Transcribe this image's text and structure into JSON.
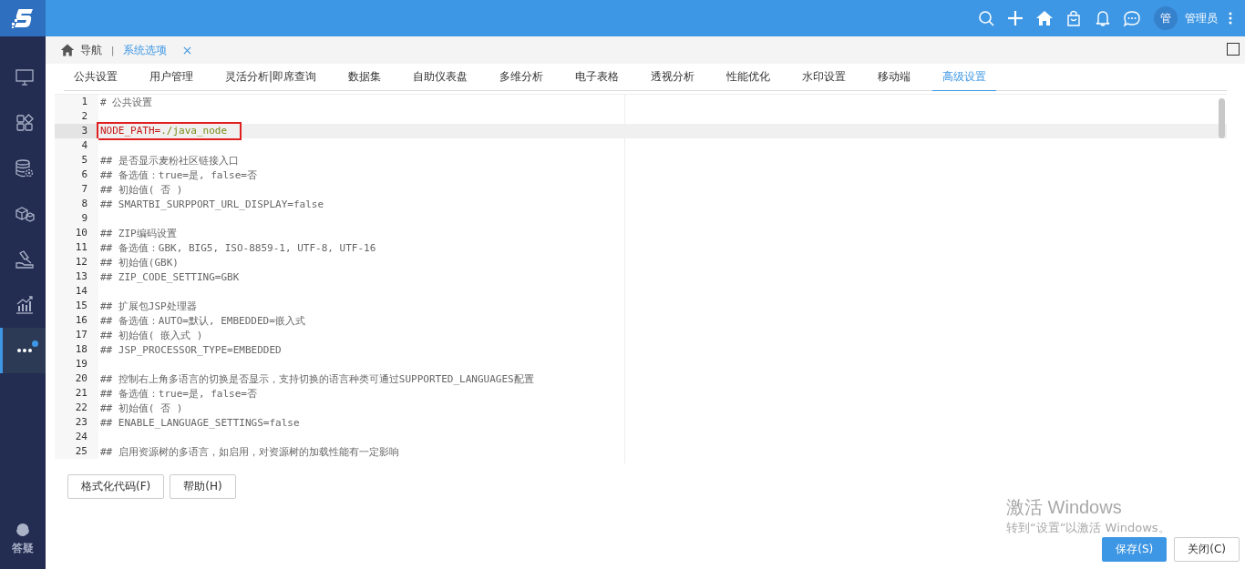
{
  "header": {
    "actions": [
      {
        "kind": "search"
      },
      {
        "kind": "plus"
      },
      {
        "kind": "home"
      },
      {
        "kind": "bag"
      },
      {
        "kind": "bell"
      },
      {
        "kind": "chat"
      }
    ],
    "avatar": "管",
    "user": "管理员"
  },
  "sidebar": {
    "items": [
      {
        "kind": "monitor",
        "selected": false,
        "badge": false
      },
      {
        "kind": "widgets",
        "selected": false,
        "badge": false
      },
      {
        "kind": "database",
        "selected": false,
        "badge": false
      },
      {
        "kind": "cubes",
        "selected": false,
        "badge": false
      },
      {
        "kind": "hammer",
        "selected": false,
        "badge": false
      },
      {
        "kind": "chart",
        "selected": false,
        "badge": false
      },
      {
        "kind": "more",
        "selected": true,
        "badge": true
      }
    ],
    "help": "答疑"
  },
  "breadcrumb": {
    "home": "导航",
    "separator": "|",
    "page": "系统选项"
  },
  "tabs": [
    {
      "label": "公共设置",
      "selected": false
    },
    {
      "label": "用户管理",
      "selected": false
    },
    {
      "label": "灵活分析|即席查询",
      "selected": false
    },
    {
      "label": "数据集",
      "selected": false
    },
    {
      "label": "自助仪表盘",
      "selected": false
    },
    {
      "label": "多维分析",
      "selected": false
    },
    {
      "label": "电子表格",
      "selected": false
    },
    {
      "label": "透视分析",
      "selected": false
    },
    {
      "label": "性能优化",
      "selected": false
    },
    {
      "label": "水印设置",
      "selected": false
    },
    {
      "label": "移动端",
      "selected": false
    },
    {
      "label": "高级设置",
      "selected": true
    }
  ],
  "editor": {
    "lines": [
      {
        "number": "1",
        "kind": "comment",
        "text": "# 公共设置",
        "current": false,
        "boxed": false
      },
      {
        "number": "2",
        "kind": "blank",
        "current": false,
        "boxed": false
      },
      {
        "number": "3",
        "kind": "setting",
        "key": "NODE_PATH",
        "separator": "=",
        "value": "./java_node",
        "current": true,
        "boxed": true
      },
      {
        "number": "4",
        "kind": "blank",
        "current": false,
        "boxed": false
      },
      {
        "number": "5",
        "kind": "comment",
        "text": "## 是否显示麦粉社区链接入口",
        "current": false,
        "boxed": false
      },
      {
        "number": "6",
        "kind": "comment",
        "text": "## 备选值：true=是, false=否",
        "current": false,
        "boxed": false
      },
      {
        "number": "7",
        "kind": "comment",
        "text": "## 初始值( 否 )",
        "current": false,
        "boxed": false
      },
      {
        "number": "8",
        "kind": "comment",
        "text": "## SMARTBI_SURPPORT_URL_DISPLAY=false",
        "current": false,
        "boxed": false
      },
      {
        "number": "9",
        "kind": "blank",
        "current": false,
        "boxed": false
      },
      {
        "number": "10",
        "kind": "comment",
        "text": "## ZIP编码设置",
        "current": false,
        "boxed": false
      },
      {
        "number": "11",
        "kind": "comment",
        "text": "## 备选值：GBK, BIG5, ISO-8859-1, UTF-8, UTF-16",
        "current": false,
        "boxed": false
      },
      {
        "number": "12",
        "kind": "comment",
        "text": "## 初始值(GBK)",
        "current": false,
        "boxed": false
      },
      {
        "number": "13",
        "kind": "comment",
        "text": "## ZIP_CODE_SETTING=GBK",
        "current": false,
        "boxed": false
      },
      {
        "number": "14",
        "kind": "blank",
        "current": false,
        "boxed": false
      },
      {
        "number": "15",
        "kind": "comment",
        "text": "## 扩展包JSP处理器",
        "current": false,
        "boxed": false
      },
      {
        "number": "16",
        "kind": "comment",
        "text": "## 备选值：AUTO=默认, EMBEDDED=嵌入式",
        "current": false,
        "boxed": false
      },
      {
        "number": "17",
        "kind": "comment",
        "text": "## 初始值( 嵌入式 )",
        "current": false,
        "boxed": false
      },
      {
        "number": "18",
        "kind": "comment",
        "text": "## JSP_PROCESSOR_TYPE=EMBEDDED",
        "current": false,
        "boxed": false
      },
      {
        "number": "19",
        "kind": "blank",
        "current": false,
        "boxed": false
      },
      {
        "number": "20",
        "kind": "comment",
        "text": "## 控制右上角多语言的切换是否显示，支持切换的语言种类可通过SUPPORTED_LANGUAGES配置",
        "current": false,
        "boxed": false
      },
      {
        "number": "21",
        "kind": "comment",
        "text": "## 备选值：true=是, false=否",
        "current": false,
        "boxed": false
      },
      {
        "number": "22",
        "kind": "comment",
        "text": "## 初始值( 否 )",
        "current": false,
        "boxed": false
      },
      {
        "number": "23",
        "kind": "comment",
        "text": "## ENABLE_LANGUAGE_SETTINGS=false",
        "current": false,
        "boxed": false
      },
      {
        "number": "24",
        "kind": "blank",
        "current": false,
        "boxed": false
      },
      {
        "number": "25",
        "kind": "comment",
        "text": "## 启用资源树的多语言，如启用，对资源树的加载性能有一定影响",
        "current": false,
        "boxed": false
      }
    ]
  },
  "editor_buttons": [
    "格式化代码(F)",
    "帮助(H)"
  ],
  "activation_notice": {
    "title": "激活 Windows",
    "subtitle": "转到“设置”以激活 Windows。"
  },
  "footer_buttons": [
    {
      "label": "保存(S)",
      "kind": "primary"
    },
    {
      "label": "关闭(C)",
      "kind": "default"
    }
  ]
}
